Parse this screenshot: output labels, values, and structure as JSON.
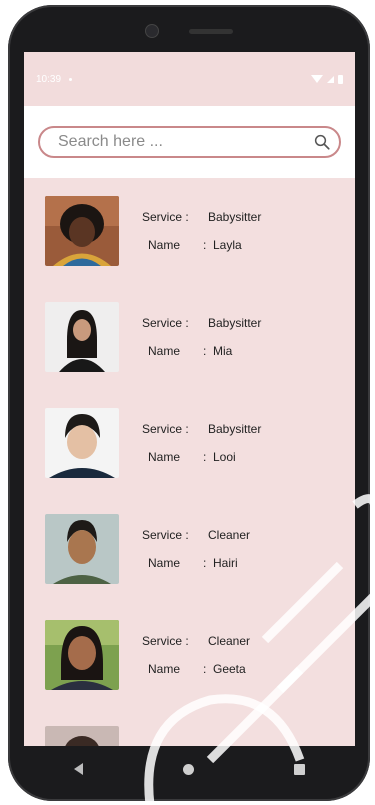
{
  "status_bar": {
    "time": "10:39"
  },
  "search": {
    "placeholder": "Search here ..."
  },
  "labels": {
    "service": "Service :",
    "name": "Name",
    "colon": ":"
  },
  "providers": [
    {
      "service": "Babysitter",
      "name": "Layla"
    },
    {
      "service": "Babysitter",
      "name": "Mia"
    },
    {
      "service": "Babysitter",
      "name": "Looi"
    },
    {
      "service": "Cleaner",
      "name": "Hairi"
    },
    {
      "service": "Cleaner",
      "name": "Geeta"
    }
  ],
  "colors": {
    "screen_bg": "#f3dfdf",
    "search_border": "#c9888a"
  },
  "icons": {
    "search": "search-icon",
    "back": "back-icon",
    "home": "home-icon",
    "recent": "recent-apps-icon"
  }
}
